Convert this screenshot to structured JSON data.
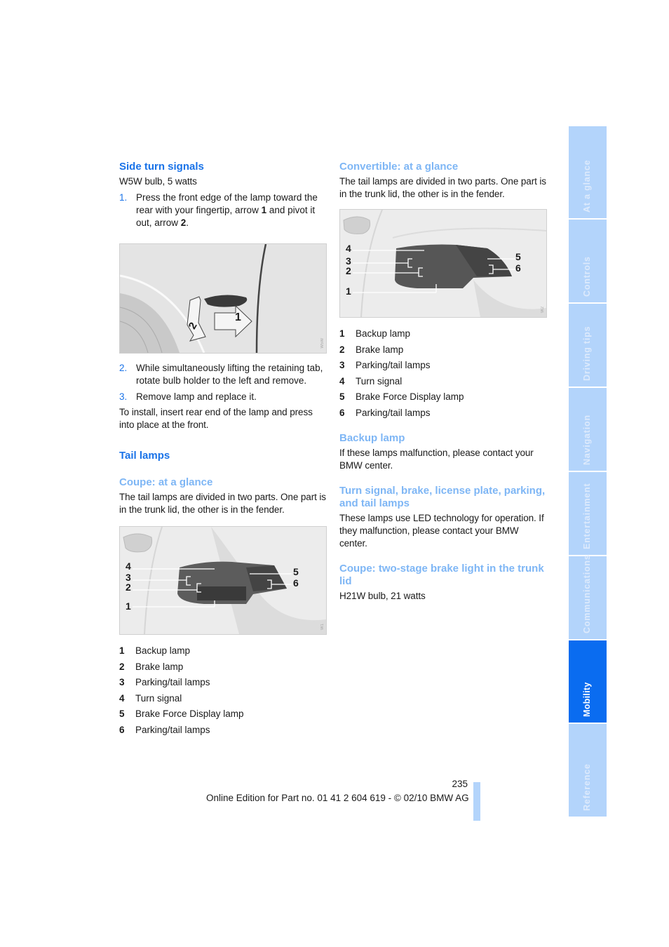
{
  "left": {
    "side_turn": {
      "title": "Side turn signals",
      "bulb": "W5W bulb, 5 watts",
      "steps": [
        {
          "num": "1.",
          "text_a": "Press the front edge of the lamp toward the rear with your fingertip, arrow ",
          "bold_a": "1",
          "text_b": " and pivot it out, arrow ",
          "bold_b": "2",
          "text_c": "."
        },
        {
          "num": "2.",
          "text": "While simultaneously lifting the retaining tab, rotate bulb holder to the left and remove."
        },
        {
          "num": "3.",
          "text": "Remove lamp and replace it."
        }
      ],
      "install": "To install, insert rear end of the lamp and press into place at the front.",
      "figure_labels": [
        "1",
        "2"
      ]
    },
    "tail_lamps": {
      "title": "Tail lamps",
      "coupe_title": "Coupe: at a glance",
      "coupe_text": "The tail lamps are divided in two parts. One part is in the trunk lid, the other is in the fender.",
      "figure_labels": [
        "4",
        "3",
        "2",
        "1",
        "5",
        "6"
      ],
      "legend": [
        {
          "n": "1",
          "label": "Backup lamp"
        },
        {
          "n": "2",
          "label": "Brake lamp"
        },
        {
          "n": "3",
          "label": "Parking/tail lamps"
        },
        {
          "n": "4",
          "label": "Turn signal"
        },
        {
          "n": "5",
          "label": "Brake Force Display lamp"
        },
        {
          "n": "6",
          "label": "Parking/tail lamps"
        }
      ]
    }
  },
  "right": {
    "convertible": {
      "title": "Convertible: at a glance",
      "text": "The tail lamps are divided in two parts. One part is in the trunk lid, the other is in the fender.",
      "figure_labels": [
        "4",
        "3",
        "2",
        "1",
        "5",
        "6"
      ],
      "legend": [
        {
          "n": "1",
          "label": "Backup lamp"
        },
        {
          "n": "2",
          "label": "Brake lamp"
        },
        {
          "n": "3",
          "label": "Parking/tail lamps"
        },
        {
          "n": "4",
          "label": "Turn signal"
        },
        {
          "n": "5",
          "label": "Brake Force Display lamp"
        },
        {
          "n": "6",
          "label": "Parking/tail lamps"
        }
      ]
    },
    "backup": {
      "title": "Backup lamp",
      "text": "If these lamps malfunction, please contact your BMW center."
    },
    "led": {
      "title": "Turn signal, brake, license plate, parking, and tail lamps",
      "text": "These lamps use LED technology for operation. If they malfunction, please contact your BMW center."
    },
    "brake_light": {
      "title": "Coupe: two-stage brake light in the trunk lid",
      "text": "H21W bulb, 21 watts"
    }
  },
  "tabs": [
    {
      "label": "At a glance",
      "active": false
    },
    {
      "label": "Controls",
      "active": false
    },
    {
      "label": "Driving tips",
      "active": false
    },
    {
      "label": "Navigation",
      "active": false
    },
    {
      "label": "Entertainment",
      "active": false
    },
    {
      "label": "Communications",
      "active": false
    },
    {
      "label": "Mobility",
      "active": true
    },
    {
      "label": "Reference",
      "active": false
    }
  ],
  "footer": {
    "page_number": "235",
    "edition": "Online Edition for Part no. 01 41 2 604 619 - © 02/10 BMW AG"
  },
  "colors": {
    "heading": "#1a73e8",
    "subheading": "#7eb6f5",
    "tab": "#b3d4fb",
    "tab_active": "#0a6cf0"
  }
}
